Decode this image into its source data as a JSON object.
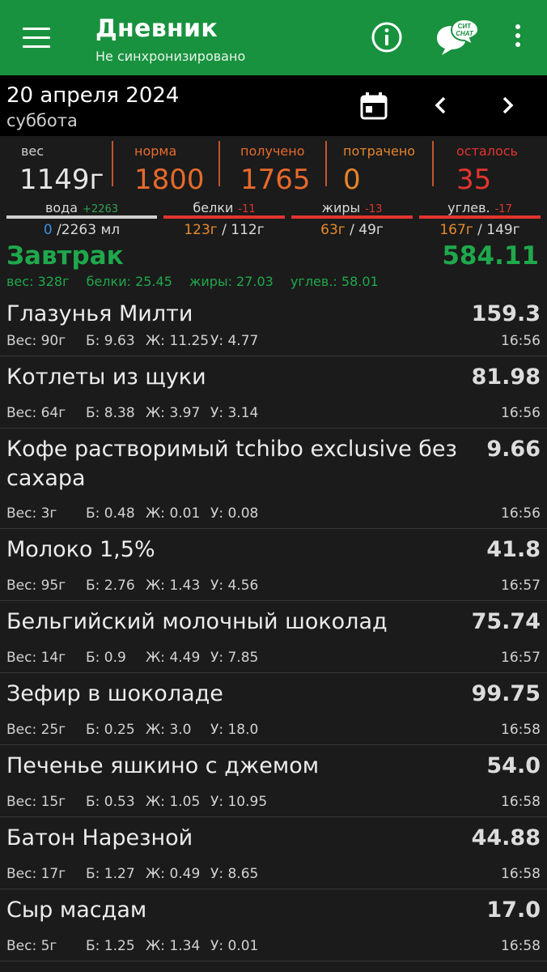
{
  "appbar": {
    "title": "Дневник",
    "subtitle": "Не синхронизировано",
    "chat_icon_text_top": "СИТ",
    "chat_icon_text_bottom": "CHAT"
  },
  "date": {
    "main": "20 апреля 2024",
    "day": "суббота"
  },
  "summary": [
    {
      "label": "вес",
      "value": "1149г",
      "label_color": "#cfcfcf",
      "value_color": "#e6e6e6"
    },
    {
      "label": "норма",
      "value": "1800",
      "label_color": "#e66a2c",
      "value_color": "#e66a2c"
    },
    {
      "label": "получено",
      "value": "1765",
      "label_color": "#e66a2c",
      "value_color": "#e66a2c"
    },
    {
      "label": "потрачено",
      "value": "0",
      "label_color": "#e6852c",
      "value_color": "#e6852c"
    },
    {
      "label": "осталось",
      "value": "35",
      "label_color": "#e2352f",
      "value_color": "#e2352f"
    }
  ],
  "macros": [
    {
      "label": "вода",
      "delta": "+2263",
      "delta_color": "#2fa24f",
      "bar_color": "#d0d0d0",
      "current": "0",
      "target": "/2263 мл",
      "current_color": "#3b8ee0"
    },
    {
      "label": "белки",
      "delta": "-11",
      "delta_color": "#e2352f",
      "bar_color": "#e2352f",
      "current": "123г",
      "target": "/ 112г",
      "current_color": "#e68a2c"
    },
    {
      "label": "жиры",
      "delta": "-13",
      "delta_color": "#e2352f",
      "bar_color": "#e2352f",
      "current": "63г",
      "target": "/ 49г",
      "current_color": "#e68a2c"
    },
    {
      "label": "углев.",
      "delta": "-17",
      "delta_color": "#e2352f",
      "bar_color": "#e2352f",
      "current": "167г",
      "target": "/ 149г",
      "current_color": "#e68a2c"
    }
  ],
  "meal": {
    "title": "Завтрак",
    "total": "584.11",
    "stats": [
      "вес: 328г",
      "белки: 25.45",
      "жиры: 27.03",
      "углев.: 58.01"
    ]
  },
  "foods": [
    {
      "name": "Глазунья Милти",
      "kcal": "159.3",
      "weight": "Вес: 90г",
      "p": "Б: 9.63",
      "f": "Ж: 11.25",
      "c": "У: 4.77",
      "time": "16:56"
    },
    {
      "name": "Котлеты из щуки",
      "kcal": "81.98",
      "weight": "Вес: 64г",
      "p": "Б: 8.38",
      "f": "Ж: 3.97",
      "c": "У: 3.14",
      "time": "16:56"
    },
    {
      "name": "Кофе растворимый tchibo exclusive без сахара",
      "kcal": "9.66",
      "weight": "Вес: 3г",
      "p": "Б: 0.48",
      "f": "Ж: 0.01",
      "c": "У: 0.08",
      "time": "16:56"
    },
    {
      "name": "Молоко 1,5%",
      "kcal": "41.8",
      "weight": "Вес: 95г",
      "p": "Б: 2.76",
      "f": "Ж: 1.43",
      "c": "У: 4.56",
      "time": "16:57"
    },
    {
      "name": "Бельгийский молочный шоколад",
      "kcal": "75.74",
      "weight": "Вес: 14г",
      "p": "Б: 0.9",
      "f": "Ж: 4.49",
      "c": "У: 7.85",
      "time": "16:57"
    },
    {
      "name": "Зефир в шоколаде",
      "kcal": "99.75",
      "weight": "Вес: 25г",
      "p": "Б: 0.25",
      "f": "Ж: 3.0",
      "c": "У: 18.0",
      "time": "16:58"
    },
    {
      "name": "Печенье яшкино с джемом",
      "kcal": "54.0",
      "weight": "Вес: 15г",
      "p": "Б: 0.53",
      "f": "Ж: 1.05",
      "c": "У: 10.95",
      "time": "16:58"
    },
    {
      "name": "Батон Нарезной",
      "kcal": "44.88",
      "weight": "Вес: 17г",
      "p": "Б: 1.27",
      "f": "Ж: 0.49",
      "c": "У: 8.65",
      "time": "16:58"
    },
    {
      "name": "Сыр масдам",
      "kcal": "17.0",
      "weight": "Вес: 5г",
      "p": "Б: 1.25",
      "f": "Ж: 1.34",
      "c": "У: 0.01",
      "time": "16:58"
    }
  ]
}
